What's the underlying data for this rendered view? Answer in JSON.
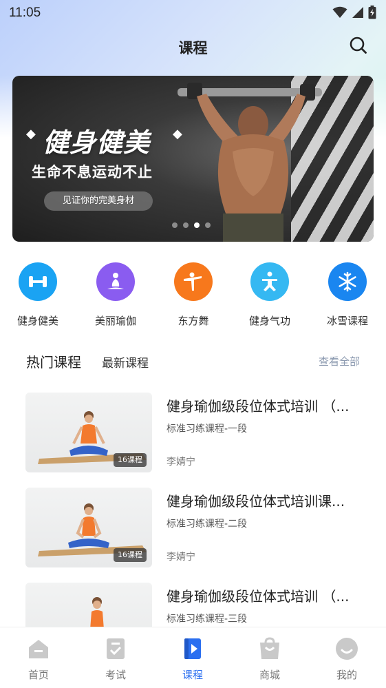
{
  "status_bar": {
    "time": "11:05"
  },
  "header": {
    "title": "课程"
  },
  "banner": {
    "headline": "健身健美",
    "slogan": "生命不息运动不止",
    "pill_text": "见证你的完美身材",
    "slides": 4,
    "active_slide": 3
  },
  "categories": [
    {
      "label": "健身健美",
      "icon": "dumbbell-icon",
      "color": "#1aa3f3"
    },
    {
      "label": "美丽瑜伽",
      "icon": "yoga-icon",
      "color": "#8a5cf0"
    },
    {
      "label": "东方舞",
      "icon": "dance-icon",
      "color": "#f7781c"
    },
    {
      "label": "健身气功",
      "icon": "qigong-icon",
      "color": "#35b8f2"
    },
    {
      "label": "冰雪课程",
      "icon": "snowflake-icon",
      "color": "#1a86f0"
    }
  ],
  "section": {
    "tab_hot": "热门课程",
    "tab_new": "最新课程",
    "view_all": "查看全部"
  },
  "courses": [
    {
      "title": "健身瑜伽级段位体式培训 （...",
      "subtitle": "标准习练课程-一段",
      "teacher": "李婧宁",
      "badge": "16课程"
    },
    {
      "title": "健身瑜伽级段位体式培训课...",
      "subtitle": "标准习练课程-二段",
      "teacher": "李婧宁",
      "badge": "16课程"
    },
    {
      "title": "健身瑜伽级段位体式培训 （...",
      "subtitle": "标准习练课程-三段",
      "teacher": "",
      "badge": ""
    }
  ],
  "bottom_nav": [
    {
      "label": "首页",
      "icon": "home-icon",
      "active": false
    },
    {
      "label": "考试",
      "icon": "exam-icon",
      "active": false
    },
    {
      "label": "课程",
      "icon": "course-icon",
      "active": true
    },
    {
      "label": "商城",
      "icon": "shop-bag-icon",
      "active": false
    },
    {
      "label": "我的",
      "icon": "profile-icon",
      "active": false
    }
  ],
  "colors": {
    "accent": "#2b6ff0",
    "inactive_icon": "#c9c9c9",
    "view_all": "#8c9ab0"
  }
}
